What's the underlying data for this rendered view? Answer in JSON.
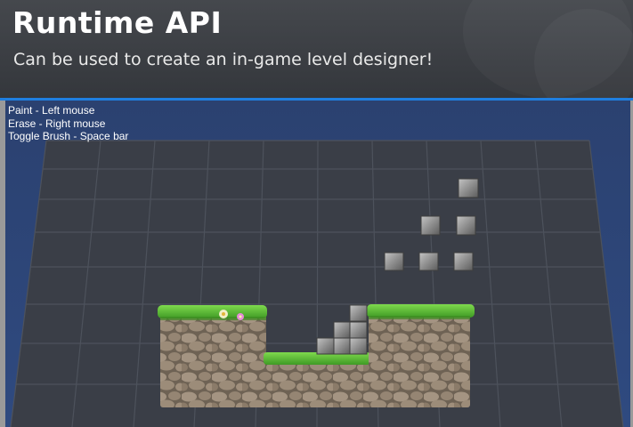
{
  "banner": {
    "title": "Runtime API",
    "subtitle": "Can be used to create an in-game level designer!"
  },
  "controls_hint": [
    "Paint - Left mouse",
    "Erase - Right mouse",
    "Toggle Brush - Space bar"
  ],
  "colors": {
    "accent_bar": "#1f7fe0",
    "viewport_background": "#2f4678",
    "grid_plane": "#3a3e47",
    "grass": "#5fc23a",
    "stone_block": "#8d8d8d",
    "rock_wall": "#8a7a68"
  },
  "icons": [
    "flower-icon",
    "flower-icon"
  ]
}
